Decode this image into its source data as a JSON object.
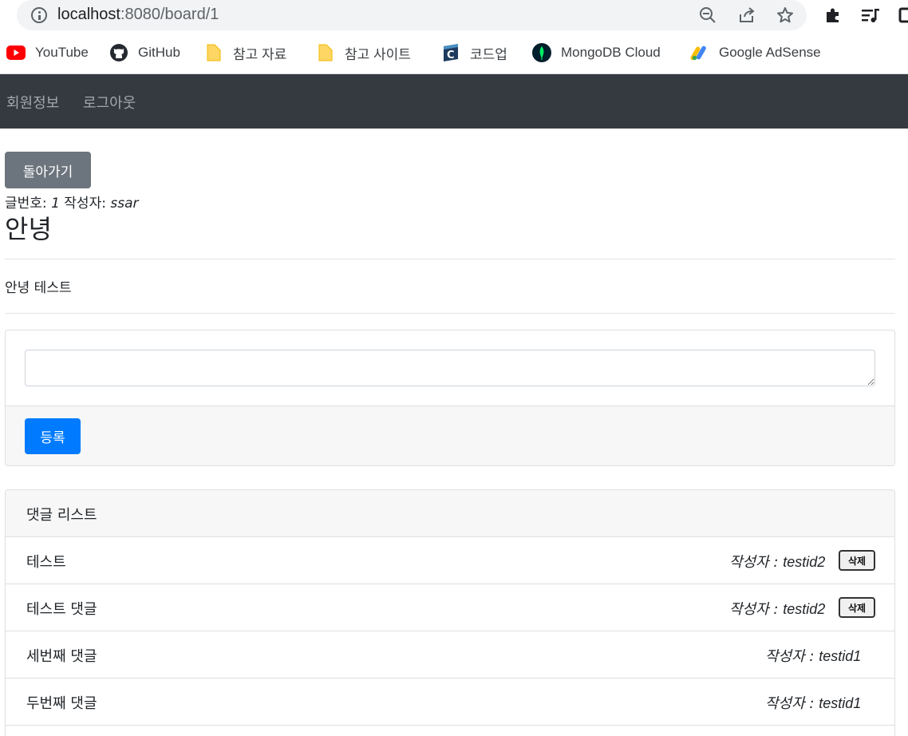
{
  "browser": {
    "url_host": "localhost",
    "url_rest": ":8080/board/1",
    "bookmarks": [
      {
        "label": "YouTube",
        "icon": "youtube-icon"
      },
      {
        "label": "GitHub",
        "icon": "github-icon"
      },
      {
        "label": "참고 자료",
        "icon": "folder-icon"
      },
      {
        "label": "참고 사이트",
        "icon": "folder-icon"
      },
      {
        "label": "코드업",
        "icon": "codeup-icon"
      },
      {
        "label": "MongoDB Cloud",
        "icon": "mongodb-icon"
      },
      {
        "label": "Google AdSense",
        "icon": "adsense-icon"
      }
    ]
  },
  "navbar": {
    "links": [
      "회원정보",
      "로그아웃"
    ]
  },
  "post": {
    "back_label": "돌아가기",
    "number_label": "글번호:",
    "number": "1",
    "author_label": "작성자:",
    "author": "ssar",
    "title": "안녕",
    "content": "안녕 테스트"
  },
  "reply_form": {
    "textarea_value": "",
    "submit_label": "등록"
  },
  "comments": {
    "header": "댓글 리스트",
    "author_prefix": "작성자 : ",
    "delete_label": "삭제",
    "items": [
      {
        "content": "테스트",
        "author": "testid2",
        "deletable": true
      },
      {
        "content": "테스트 댓글",
        "author": "testid2",
        "deletable": true
      },
      {
        "content": "세번째 댓글",
        "author": "testid1",
        "deletable": false
      },
      {
        "content": "두번째 댓글",
        "author": "testid1",
        "deletable": false
      }
    ]
  },
  "colors": {
    "navbar_bg": "#343a40",
    "back_button": "#6c757d",
    "submit_button": "#007bff"
  }
}
